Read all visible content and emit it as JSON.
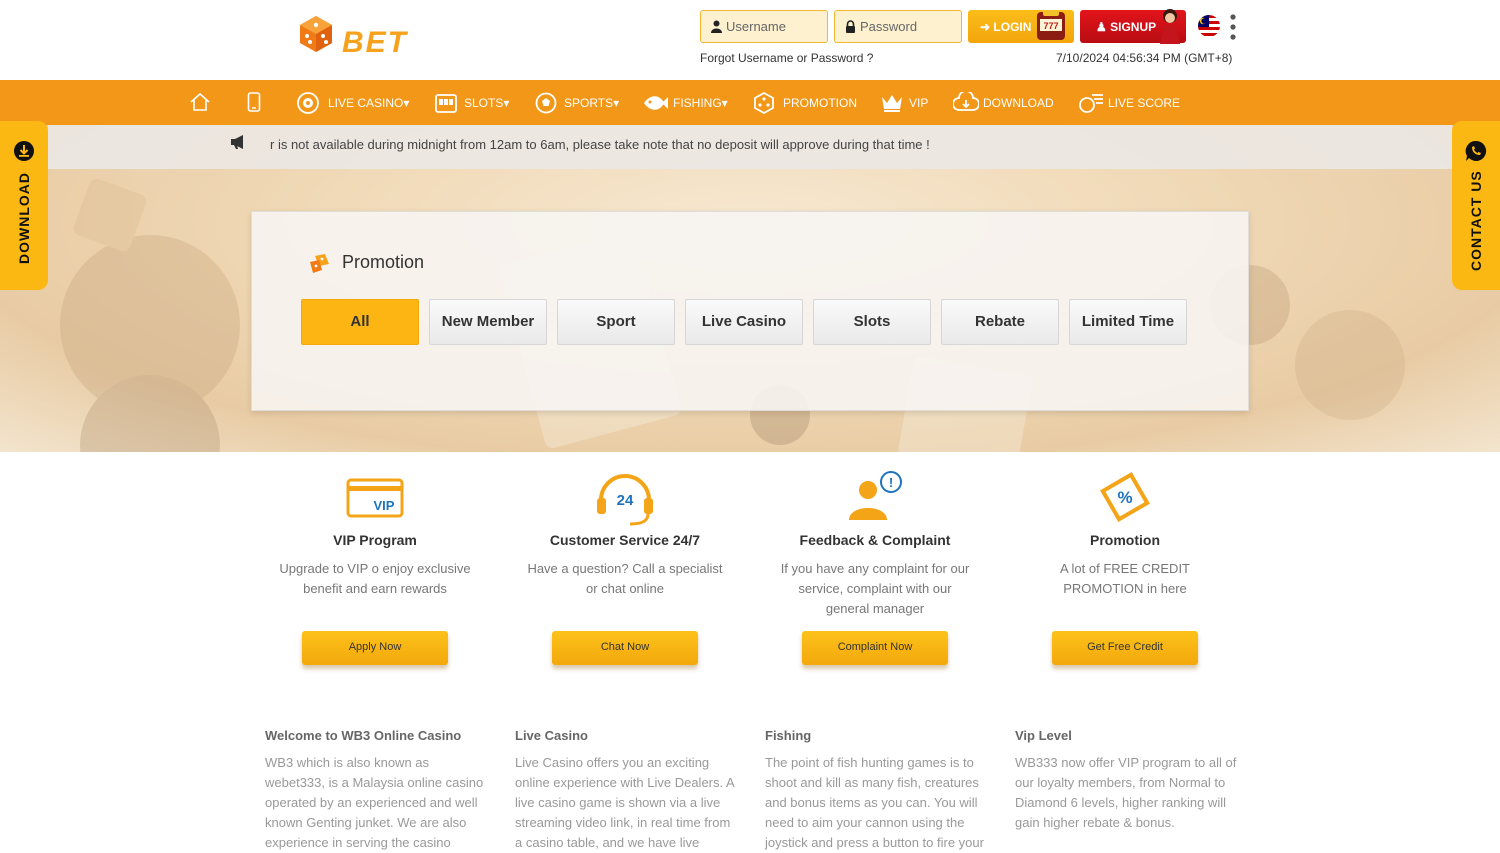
{
  "brand": {
    "logo_text": "BET",
    "colors": {
      "primary": "#f29718",
      "button": "#fcb512",
      "signup": "#d01016",
      "side_tab": "#fcb812"
    }
  },
  "header": {
    "username_placeholder": "Username",
    "password_placeholder": "Password",
    "login_label": "LOGIN",
    "signup_label": "SIGNUP",
    "forgot_text": "Forgot Username or Password ?",
    "datetime": "7/10/2024 04:56:34 PM (GMT+8)"
  },
  "nav": {
    "items": [
      {
        "label": "",
        "icon": "home-icon"
      },
      {
        "label": "",
        "icon": "mobile-icon"
      },
      {
        "label": "LIVE CASINO",
        "icon": "roulette-icon",
        "dropdown": true
      },
      {
        "label": "SLOTS",
        "icon": "slot-machine-icon",
        "dropdown": true
      },
      {
        "label": "SPORTS",
        "icon": "soccer-ball-icon",
        "dropdown": true
      },
      {
        "label": "FISHING",
        "icon": "fish-icon",
        "dropdown": true
      },
      {
        "label": "PROMOTION",
        "icon": "promotion-dice-icon",
        "dropdown": false
      },
      {
        "label": "VIP",
        "icon": "crown-icon",
        "dropdown": false
      },
      {
        "label": "DOWNLOAD",
        "icon": "download-icon",
        "dropdown": false
      },
      {
        "label": "LIVE SCORE",
        "icon": "live-score-icon",
        "dropdown": false
      }
    ]
  },
  "side": {
    "left_label": "DOWNLOAD",
    "right_label": "CONTACT US"
  },
  "announcement": "r is not available during midnight from 12am to 6am, please take note that no deposit will approve during that time !",
  "promotion": {
    "title": "Promotion",
    "tabs": [
      "All",
      "New Member",
      "Sport",
      "Live Casino",
      "Slots",
      "Rebate",
      "Limited Time"
    ],
    "active_tab": "All"
  },
  "features": [
    {
      "title": "VIP Program",
      "desc": "Upgrade to VIP o enjoy exclusive benefit and earn rewards",
      "button": "Apply Now",
      "icon": "vip-card-icon",
      "icon_text": "VIP"
    },
    {
      "title": "Customer Service 24/7",
      "desc": "Have a question? Call a specialist or chat online",
      "button": "Chat Now",
      "icon": "headset-24-icon",
      "icon_text": "24"
    },
    {
      "title": "Feedback & Complaint",
      "desc": "If you have any complaint for our service, complaint with our general manager",
      "button": "Complaint Now",
      "icon": "feedback-person-icon",
      "icon_text": "!"
    },
    {
      "title": "Promotion",
      "desc": "A lot of FREE CREDIT PROMOTION in here",
      "button": "Get Free Credit",
      "icon": "percent-tag-icon",
      "icon_text": "%"
    }
  ],
  "info": [
    {
      "title": "Welcome to WB3 Online Casino",
      "body": "WB3 which is also known as webet333, is a Malaysia online casino operated by an experienced and well known Genting junket. We are also experience in serving the casino"
    },
    {
      "title": "Live Casino",
      "body": "Live Casino offers you an exciting online experience with Live Dealers. A live casino game is shown via a live streaming video link, in real time from a casino table, and we have live"
    },
    {
      "title": "Fishing",
      "body": "The point of fish hunting games is to shoot and kill as many fish, creatures and bonus items as you can. You will need to aim your cannon using the joystick and press a button to fire your"
    },
    {
      "title": "Vip Level",
      "body": "WB333 now offer VIP program to all of our loyalty members, from Normal to Diamond 6 levels, higher ranking will gain higher rebate & bonus."
    }
  ]
}
